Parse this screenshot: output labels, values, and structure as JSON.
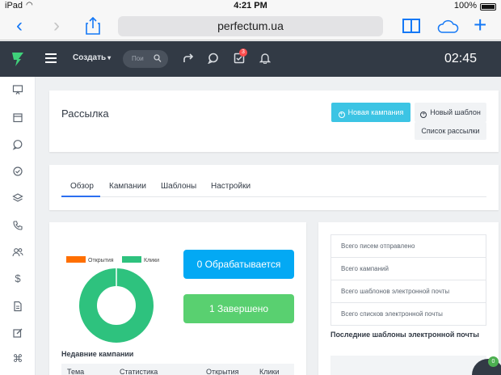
{
  "status_bar": {
    "carrier": "iPad",
    "time": "4:21 PM",
    "battery": "100%"
  },
  "browser": {
    "url": "perfectum.ua"
  },
  "header": {
    "create_label": "Создать",
    "search_placeholder": "Пои",
    "notification_badge": "3",
    "clock": "02:45"
  },
  "page": {
    "title": "Рассылка",
    "buttons": {
      "new_campaign": "Новая кампания",
      "new_template": "Новый шаблон",
      "mailing_lists": "Список рассылки"
    }
  },
  "tabs": [
    {
      "label": "Обзор",
      "active": true
    },
    {
      "label": "Кампании",
      "active": false
    },
    {
      "label": "Шаблоны",
      "active": false
    },
    {
      "label": "Настройки",
      "active": false
    }
  ],
  "chart_data": {
    "type": "pie",
    "legend": [
      "Открытия",
      "Клики"
    ],
    "colors": {
      "Открытия": "#ff6f00",
      "Клики": "#2ec27e"
    },
    "values": [
      0,
      1
    ]
  },
  "stats": {
    "processing": "0 Обрабатывается",
    "completed": "1 Завершено"
  },
  "recent": {
    "title": "Недавние кампании",
    "columns": [
      "Тема",
      "Статистика",
      "Открытия",
      "Клики"
    ]
  },
  "summary": {
    "rows": [
      "Всего писем отправлено",
      "Всего кампаний",
      "Всего шаблонов электронной почты",
      "Всего списков электронной почты"
    ],
    "recent_templates_title": "Последние шаблоны электронной почты"
  },
  "help_badge": "0"
}
